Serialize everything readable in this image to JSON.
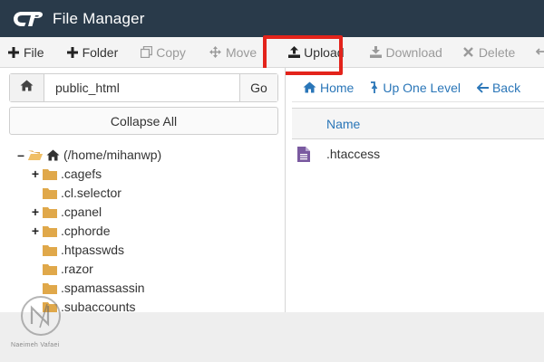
{
  "header": {
    "title": "File Manager"
  },
  "toolbar": {
    "file": "File",
    "folder": "Folder",
    "copy": "Copy",
    "move": "Move",
    "upload": "Upload",
    "download": "Download",
    "delete": "Delete"
  },
  "left": {
    "path_value": "public_html",
    "go_label": "Go",
    "collapse_label": "Collapse All",
    "tree": {
      "root": "(/home/mihanwp)",
      "items": [
        {
          "label": ".cagefs",
          "expandable": true
        },
        {
          "label": ".cl.selector",
          "expandable": false
        },
        {
          "label": ".cpanel",
          "expandable": true
        },
        {
          "label": ".cphorde",
          "expandable": true
        },
        {
          "label": ".htpasswds",
          "expandable": false
        },
        {
          "label": ".razor",
          "expandable": false
        },
        {
          "label": ".spamassassin",
          "expandable": false
        },
        {
          "label": ".subaccounts",
          "expandable": false
        }
      ]
    }
  },
  "right": {
    "nav": {
      "home": "Home",
      "up": "Up One Level",
      "back": "Back"
    },
    "table": {
      "header_name": "Name",
      "rows": [
        {
          "name": ".htaccess"
        }
      ]
    }
  },
  "watermark": {
    "text": "Naeimeh Vafaei"
  },
  "colors": {
    "header_bg": "#293a4a",
    "link": "#2a76b8",
    "folder": "#e0a84a",
    "highlight": "#e3231b",
    "file_icon": "#7a5aa0"
  }
}
